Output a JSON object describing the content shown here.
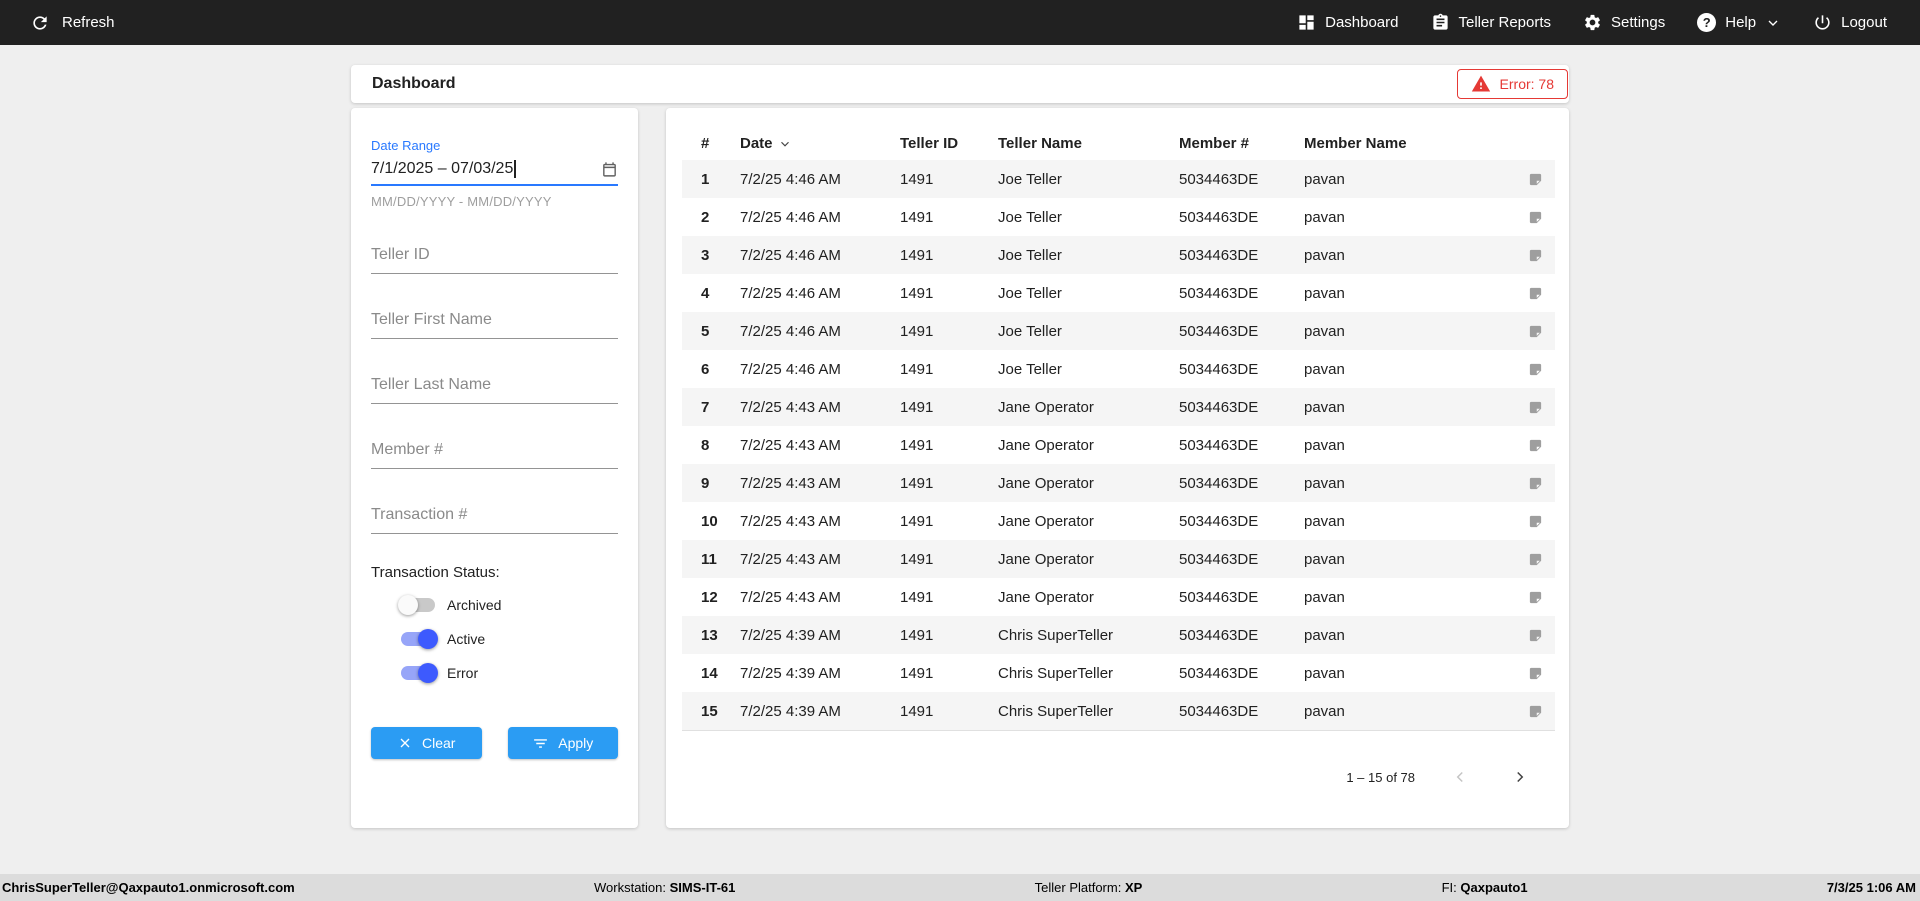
{
  "topbar": {
    "refresh_label": "Refresh",
    "nav": [
      {
        "label": "Dashboard"
      },
      {
        "label": "Teller Reports"
      },
      {
        "label": "Settings"
      },
      {
        "label": "Help"
      },
      {
        "label": "Logout"
      }
    ]
  },
  "header": {
    "title": "Dashboard",
    "error_badge": "Error: 78"
  },
  "filters": {
    "date_range": {
      "label": "Date Range",
      "value": "7/1/2025 – 07/03/25",
      "helper": "MM/DD/YYYY - MM/DD/YYYY"
    },
    "fields": [
      {
        "placeholder": "Teller ID"
      },
      {
        "placeholder": "Teller First Name"
      },
      {
        "placeholder": "Teller Last Name"
      },
      {
        "placeholder": "Member #"
      },
      {
        "placeholder": "Transaction #"
      }
    ],
    "status": {
      "label": "Transaction Status:",
      "toggles": [
        {
          "label": "Archived",
          "on": false
        },
        {
          "label": "Active",
          "on": true
        },
        {
          "label": "Error",
          "on": true
        }
      ]
    },
    "clear_label": "Clear",
    "apply_label": "Apply"
  },
  "table": {
    "columns": [
      "#",
      "Date",
      "Teller ID",
      "Teller Name",
      "Member #",
      "Member Name"
    ],
    "rows": [
      {
        "num": "1",
        "date": "7/2/25 4:46 AM",
        "teller_id": "1491",
        "teller_name": "Joe Teller",
        "member_num": "5034463DE",
        "member_name": "pavan"
      },
      {
        "num": "2",
        "date": "7/2/25 4:46 AM",
        "teller_id": "1491",
        "teller_name": "Joe Teller",
        "member_num": "5034463DE",
        "member_name": "pavan"
      },
      {
        "num": "3",
        "date": "7/2/25 4:46 AM",
        "teller_id": "1491",
        "teller_name": "Joe Teller",
        "member_num": "5034463DE",
        "member_name": "pavan"
      },
      {
        "num": "4",
        "date": "7/2/25 4:46 AM",
        "teller_id": "1491",
        "teller_name": "Joe Teller",
        "member_num": "5034463DE",
        "member_name": "pavan"
      },
      {
        "num": "5",
        "date": "7/2/25 4:46 AM",
        "teller_id": "1491",
        "teller_name": "Joe Teller",
        "member_num": "5034463DE",
        "member_name": "pavan"
      },
      {
        "num": "6",
        "date": "7/2/25 4:46 AM",
        "teller_id": "1491",
        "teller_name": "Joe Teller",
        "member_num": "5034463DE",
        "member_name": "pavan"
      },
      {
        "num": "7",
        "date": "7/2/25 4:43 AM",
        "teller_id": "1491",
        "teller_name": "Jane Operator",
        "member_num": "5034463DE",
        "member_name": "pavan"
      },
      {
        "num": "8",
        "date": "7/2/25 4:43 AM",
        "teller_id": "1491",
        "teller_name": "Jane Operator",
        "member_num": "5034463DE",
        "member_name": "pavan"
      },
      {
        "num": "9",
        "date": "7/2/25 4:43 AM",
        "teller_id": "1491",
        "teller_name": "Jane Operator",
        "member_num": "5034463DE",
        "member_name": "pavan"
      },
      {
        "num": "10",
        "date": "7/2/25 4:43 AM",
        "teller_id": "1491",
        "teller_name": "Jane Operator",
        "member_num": "5034463DE",
        "member_name": "pavan"
      },
      {
        "num": "11",
        "date": "7/2/25 4:43 AM",
        "teller_id": "1491",
        "teller_name": "Jane Operator",
        "member_num": "5034463DE",
        "member_name": "pavan"
      },
      {
        "num": "12",
        "date": "7/2/25 4:43 AM",
        "teller_id": "1491",
        "teller_name": "Jane Operator",
        "member_num": "5034463DE",
        "member_name": "pavan"
      },
      {
        "num": "13",
        "date": "7/2/25 4:39 AM",
        "teller_id": "1491",
        "teller_name": "Chris SuperTeller",
        "member_num": "5034463DE",
        "member_name": "pavan"
      },
      {
        "num": "14",
        "date": "7/2/25 4:39 AM",
        "teller_id": "1491",
        "teller_name": "Chris SuperTeller",
        "member_num": "5034463DE",
        "member_name": "pavan"
      },
      {
        "num": "15",
        "date": "7/2/25 4:39 AM",
        "teller_id": "1491",
        "teller_name": "Chris SuperTeller",
        "member_num": "5034463DE",
        "member_name": "pavan"
      }
    ],
    "pagination": {
      "range": "1 – 15 of 78"
    }
  },
  "footer": {
    "user": "ChrisSuperTeller@Qaxpauto1.onmicrosoft.com",
    "workstation_label": "Workstation:",
    "workstation": "SIMS-IT-61",
    "platform_label": "Teller Platform:",
    "platform": "XP",
    "fi_label": "FI:",
    "fi": "Qaxpauto1",
    "datetime": "7/3/25 1:06 AM"
  },
  "colors": {
    "topbar_bg": "#212121",
    "accent_blue": "#2b9cf3",
    "focus_blue": "#2979ff",
    "toggle_blue": "#3d5afe",
    "error_red": "#e53935",
    "row_alt_bg": "#f5f5f5"
  }
}
